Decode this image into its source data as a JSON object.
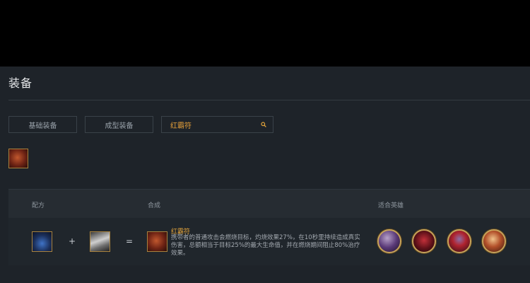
{
  "page": {
    "title": "装备"
  },
  "filters": {
    "basic_label": "基础装备",
    "formed_label": "成型装备"
  },
  "search": {
    "value": "红霸符",
    "icon": "search-icon"
  },
  "selected_item": {
    "icon": "crest-of-cinders-icon"
  },
  "table": {
    "headers": {
      "recipe": "配方",
      "compose": "合成",
      "heroes": "适合英雄"
    },
    "row": {
      "ingredients": [
        {
          "icon": "blue-gem-bag-icon"
        },
        {
          "icon": "anvil-icon"
        }
      ],
      "plus": "+",
      "equals": "=",
      "result": {
        "icon": "crest-of-cinders-icon",
        "name": "红霸符",
        "description": "携带者的普通攻击会燃烧目标，灼烧效果27%，在10秒里持续造成真实伤害，总额相当于目标25%的最大生命值，并在燃烧期间阻止80%治疗效果。"
      },
      "heroes": [
        {
          "icon": "hero-portrait-1"
        },
        {
          "icon": "hero-portrait-2"
        },
        {
          "icon": "hero-portrait-3"
        },
        {
          "icon": "hero-portrait-4"
        }
      ]
    }
  },
  "colors": {
    "accent": "#e0a23b",
    "background": "#1e2329",
    "border_gold": "#a8823e"
  }
}
